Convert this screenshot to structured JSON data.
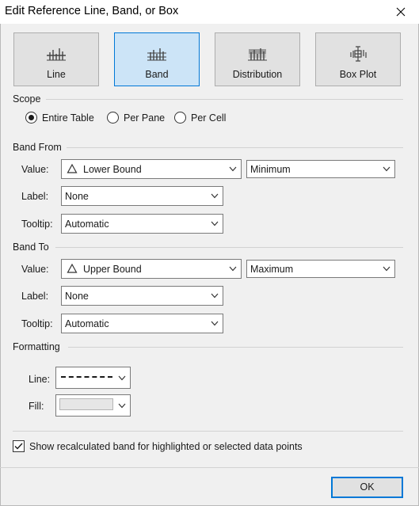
{
  "window": {
    "title": "Edit Reference Line, Band, or Box"
  },
  "type_buttons": [
    {
      "label": "Line",
      "active": false
    },
    {
      "label": "Band",
      "active": true
    },
    {
      "label": "Distribution",
      "active": false
    },
    {
      "label": "Box Plot",
      "active": false
    }
  ],
  "scope": {
    "heading": "Scope",
    "options": [
      {
        "label": "Entire Table",
        "selected": true
      },
      {
        "label": "Per Pane",
        "selected": false
      },
      {
        "label": "Per Cell",
        "selected": false
      }
    ]
  },
  "band_from": {
    "heading": "Band From",
    "value_label": "Value:",
    "value": "Lower Bound",
    "aggregation": "Minimum",
    "label_label": "Label:",
    "label": "None",
    "tooltip_label": "Tooltip:",
    "tooltip": "Automatic"
  },
  "band_to": {
    "heading": "Band To",
    "value_label": "Value:",
    "value": "Upper Bound",
    "aggregation": "Maximum",
    "label_label": "Label:",
    "label": "None",
    "tooltip_label": "Tooltip:",
    "tooltip": "Automatic"
  },
  "formatting": {
    "heading": "Formatting",
    "line_label": "Line:",
    "fill_label": "Fill:",
    "fill_color": "#e6e6e6"
  },
  "recalc_checkbox": {
    "label": "Show recalculated band for highlighted or selected data points",
    "checked": true
  },
  "ok_button": {
    "label": "OK"
  },
  "colors": {
    "accent": "#0078d7",
    "active_fill": "#cce4f7"
  }
}
